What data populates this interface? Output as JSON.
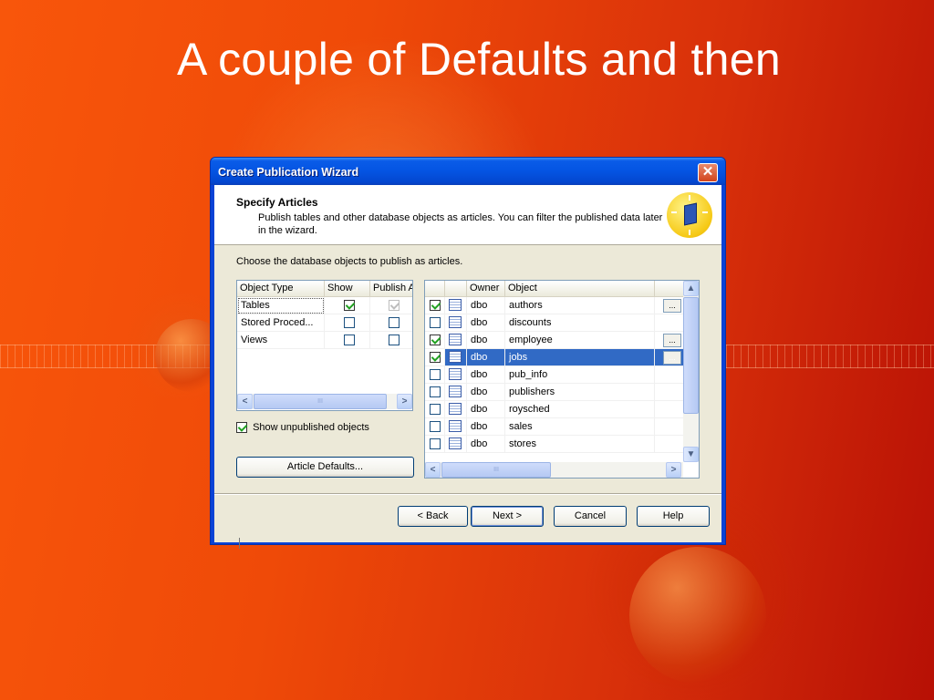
{
  "slide": {
    "title": "A couple of Defaults and then"
  },
  "window": {
    "title": "Create Publication Wizard",
    "close_symbol": "✕"
  },
  "header": {
    "title": "Specify Articles",
    "description": "Publish tables and other database objects as articles. You can filter the published data later in the wizard."
  },
  "intro_text": "Choose the database objects to publish as articles.",
  "object_types": {
    "columns": [
      "Object Type",
      "Show",
      "Publish A"
    ],
    "rows": [
      {
        "type": "Tables",
        "show": true,
        "publish": true
      },
      {
        "type": "Stored Proced...",
        "show": false,
        "publish": false
      },
      {
        "type": "Views",
        "show": false,
        "publish": false
      }
    ],
    "scroll_thumb_grip": "III",
    "scroll_left": "<",
    "scroll_right": ">"
  },
  "objects": {
    "columns": [
      "",
      "",
      "Owner",
      "Object"
    ],
    "rows": [
      {
        "checked": true,
        "owner": "dbo",
        "object": "authors",
        "has_ellipsis": true,
        "selected": false
      },
      {
        "checked": false,
        "owner": "dbo",
        "object": "discounts",
        "has_ellipsis": false,
        "selected": false
      },
      {
        "checked": true,
        "owner": "dbo",
        "object": "employee",
        "has_ellipsis": true,
        "selected": false
      },
      {
        "checked": true,
        "owner": "dbo",
        "object": "jobs",
        "has_ellipsis": true,
        "selected": true
      },
      {
        "checked": false,
        "owner": "dbo",
        "object": "pub_info",
        "has_ellipsis": false,
        "selected": false
      },
      {
        "checked": false,
        "owner": "dbo",
        "object": "publishers",
        "has_ellipsis": false,
        "selected": false
      },
      {
        "checked": false,
        "owner": "dbo",
        "object": "roysched",
        "has_ellipsis": false,
        "selected": false
      },
      {
        "checked": false,
        "owner": "dbo",
        "object": "sales",
        "has_ellipsis": false,
        "selected": false
      },
      {
        "checked": false,
        "owner": "dbo",
        "object": "stores",
        "has_ellipsis": false,
        "selected": false
      }
    ],
    "ellipsis_label": "...",
    "scroll_thumb_grip": "III"
  },
  "show_unpublished": {
    "label": "Show unpublished objects",
    "checked": true
  },
  "buttons": {
    "article_defaults": "Article Defaults...",
    "back": "< Back",
    "next": "Next >",
    "cancel": "Cancel",
    "help": "Help"
  },
  "colors": {
    "selection": "#316ac5",
    "titlebar": "#0454e2",
    "background_start": "#f8560b",
    "background_end": "#b71005"
  }
}
